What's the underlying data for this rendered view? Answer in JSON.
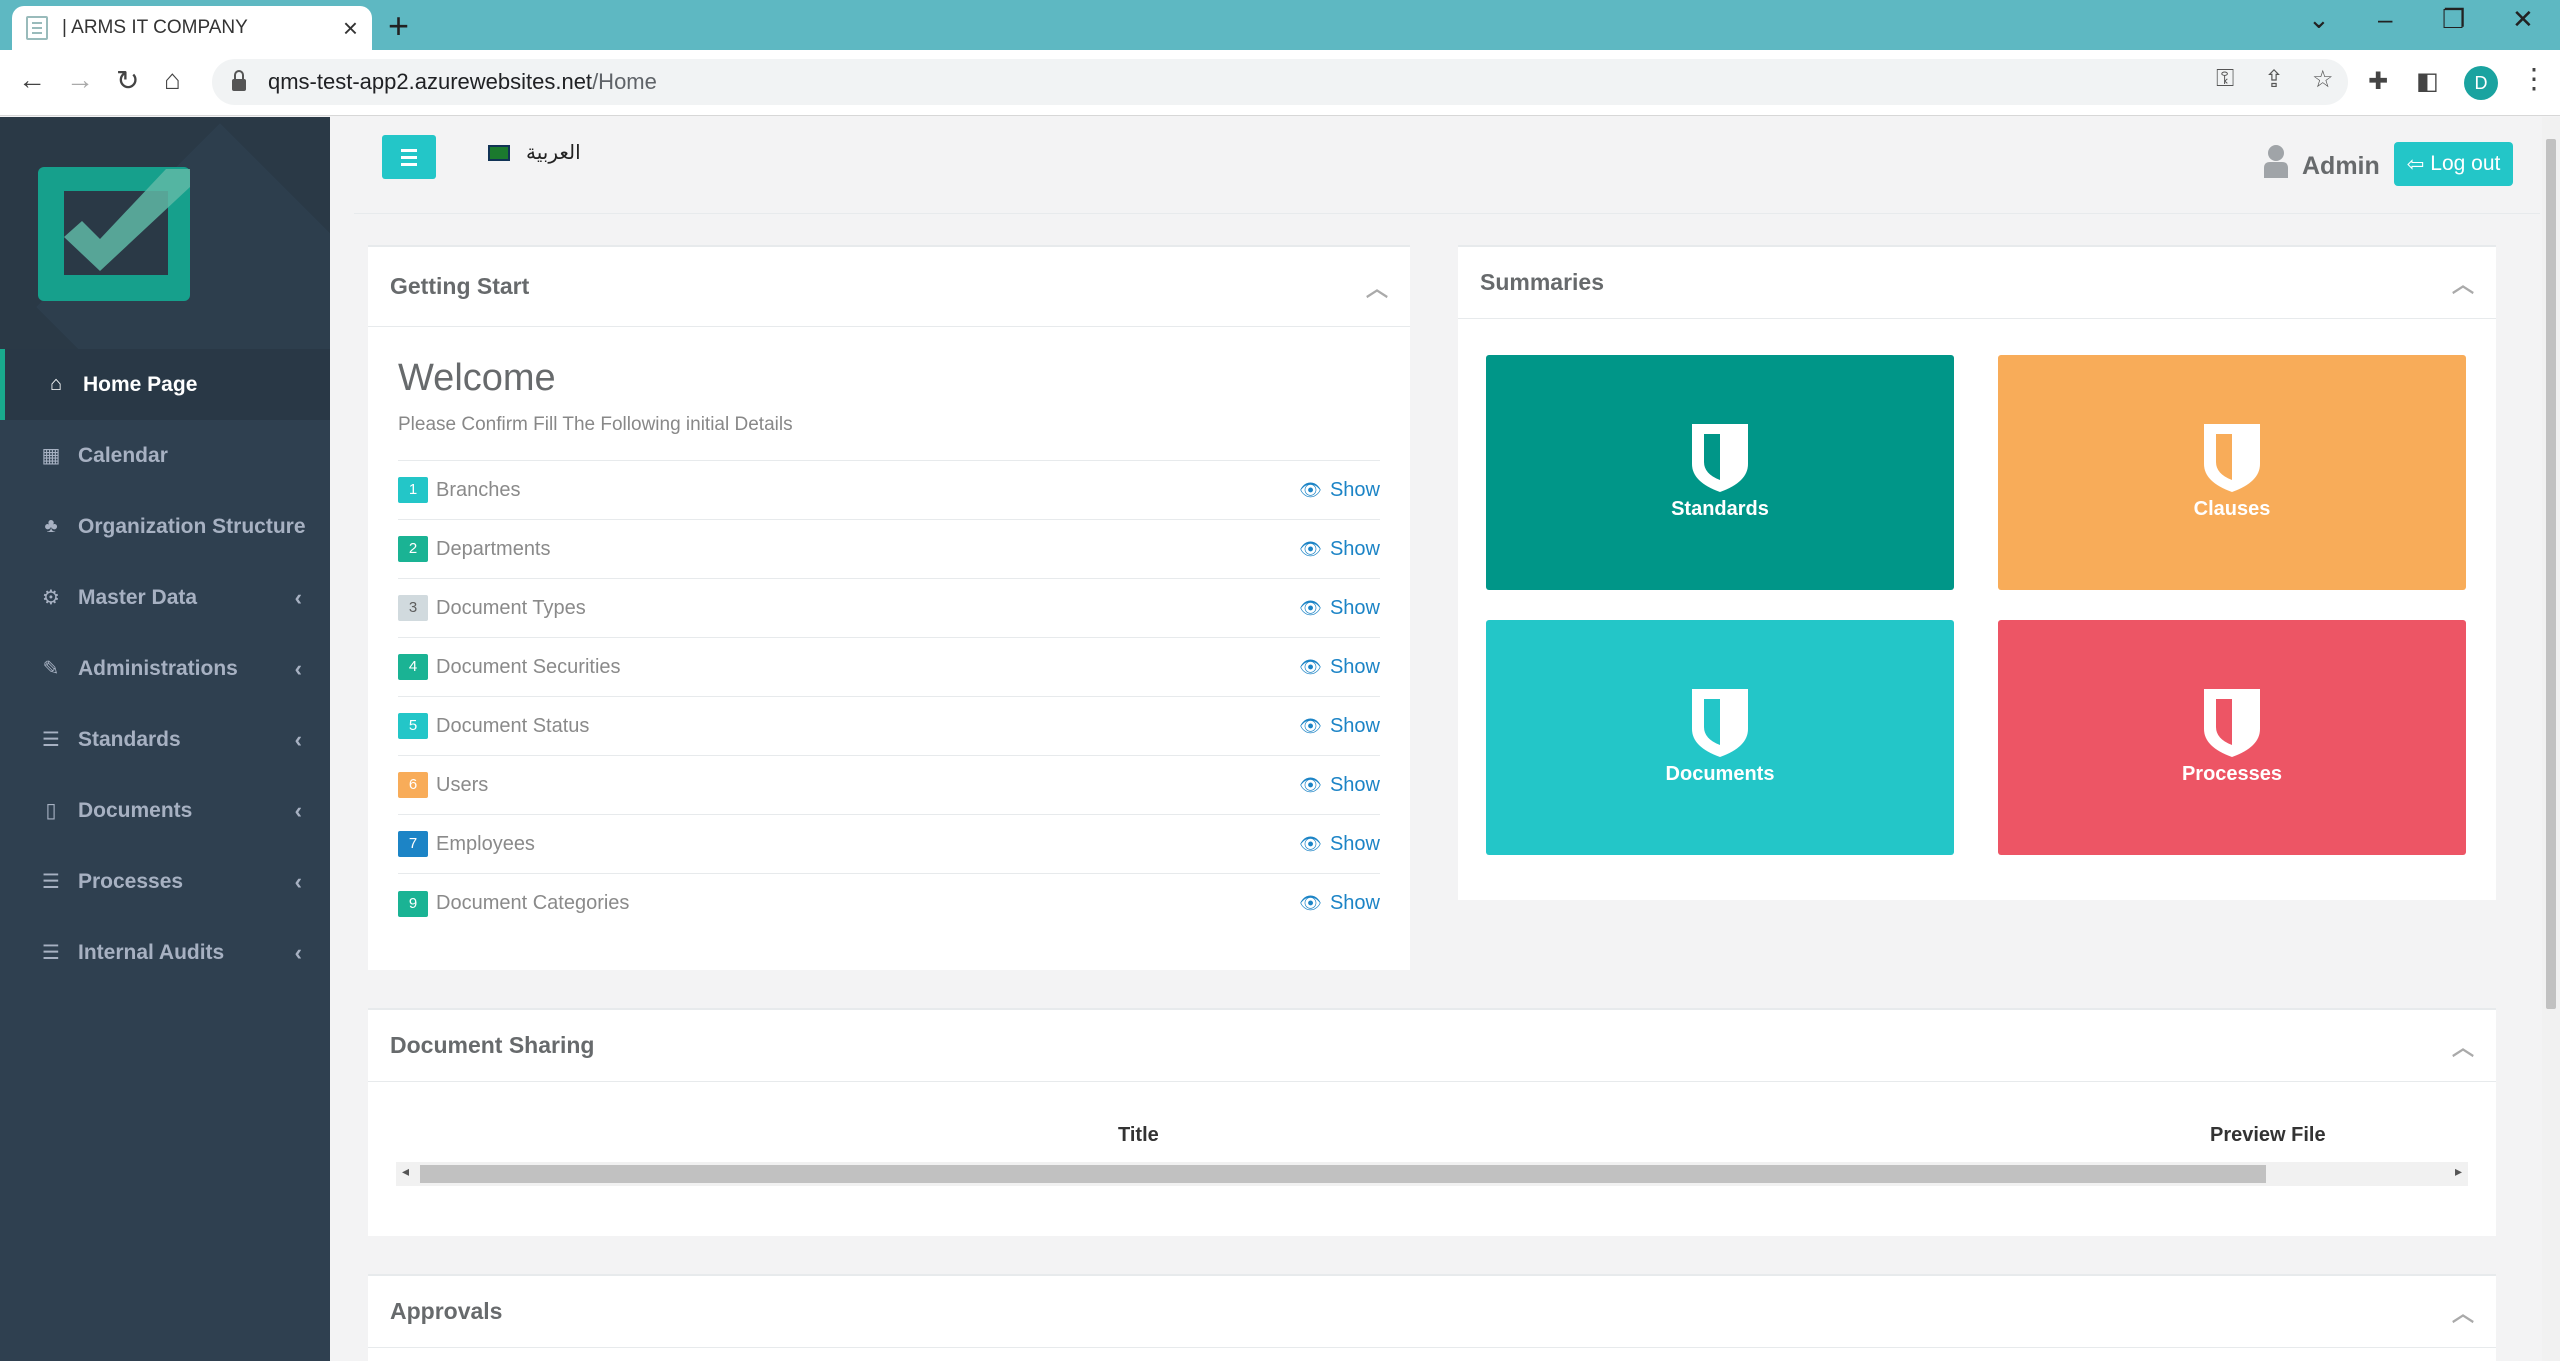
{
  "browser": {
    "tab_title": "| ARMS IT COMPANY",
    "url_host": "qms-test-app2.azurewebsites.net",
    "url_path": "/Home",
    "profile_initial": "D"
  },
  "sidebar": {
    "items": [
      {
        "label": "Home Page",
        "icon": "home-icon"
      },
      {
        "label": "Calendar",
        "icon": "calendar-icon"
      },
      {
        "label": "Organization Structure",
        "icon": "tree-icon"
      },
      {
        "label": "Master Data",
        "icon": "bicycle-icon"
      },
      {
        "label": "Administrations",
        "icon": "edit-icon"
      },
      {
        "label": "Standards",
        "icon": "list-icon"
      },
      {
        "label": "Documents",
        "icon": "file-icon"
      },
      {
        "label": "Processes",
        "icon": "list-icon"
      },
      {
        "label": "Internal Audits",
        "icon": "list-icon"
      }
    ]
  },
  "header": {
    "language": "العربية",
    "user": "Admin",
    "logout": "Log out"
  },
  "getting_start": {
    "title": "Getting Start",
    "welcome": "Welcome",
    "subtitle": "Please Confirm Fill The Following initial Details",
    "show_label": "Show",
    "steps": [
      {
        "num": "1",
        "label": "Branches",
        "color": "#23c6c8"
      },
      {
        "num": "2",
        "label": "Departments",
        "color": "#1ab394"
      },
      {
        "num": "3",
        "label": "Document Types",
        "color": "#d1dade"
      },
      {
        "num": "4",
        "label": "Document Securities",
        "color": "#1ab394"
      },
      {
        "num": "5",
        "label": "Document Status",
        "color": "#23c6c8"
      },
      {
        "num": "6",
        "label": "Users",
        "color": "#f8ac59"
      },
      {
        "num": "7",
        "label": "Employees",
        "color": "#1c84c6"
      },
      {
        "num": "9",
        "label": "Document Categories",
        "color": "#1ab394"
      }
    ]
  },
  "summaries": {
    "title": "Summaries",
    "tiles": [
      {
        "label": "Standards",
        "color": "#009688"
      },
      {
        "label": "Clauses",
        "color": "#f8ac59"
      },
      {
        "label": "Documents",
        "color": "#23c6c8"
      },
      {
        "label": "Processes",
        "color": "#ed5565"
      }
    ]
  },
  "document_sharing": {
    "title": "Document Sharing",
    "columns": [
      "Title",
      "Preview File"
    ]
  },
  "approvals": {
    "title": "Approvals"
  }
}
